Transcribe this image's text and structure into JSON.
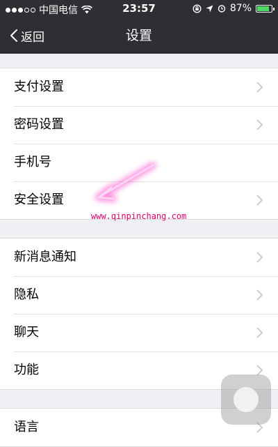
{
  "status_bar": {
    "carrier": "中国电信",
    "time": "23:57",
    "battery_percent": "87%",
    "battery_level": 0.87,
    "signal_filled": 3,
    "signal_total": 5,
    "icons": [
      "wifi-icon",
      "rotation-lock-icon",
      "location-icon",
      "alarm-icon",
      "battery-icon"
    ]
  },
  "nav": {
    "back_label": "返回",
    "title": "设置"
  },
  "groups": [
    {
      "items": [
        {
          "label": "支付设置",
          "chevron": true
        },
        {
          "label": "密码设置",
          "chevron": true
        },
        {
          "label": "手机号",
          "chevron": false
        },
        {
          "label": "安全设置",
          "chevron": true
        }
      ]
    },
    {
      "items": [
        {
          "label": "新消息通知",
          "chevron": true
        },
        {
          "label": "隐私",
          "chevron": true
        },
        {
          "label": "聊天",
          "chevron": true
        },
        {
          "label": "功能",
          "chevron": true
        }
      ]
    },
    {
      "items": [
        {
          "label": "语言",
          "chevron": true
        }
      ]
    }
  ],
  "watermark": "www.qinpinchang.com",
  "colors": {
    "bar": "#2f2f33",
    "background": "#efeff4",
    "watermark": "#e3006e",
    "chevron": "#c7c7cc",
    "battery": "#4cd964"
  }
}
